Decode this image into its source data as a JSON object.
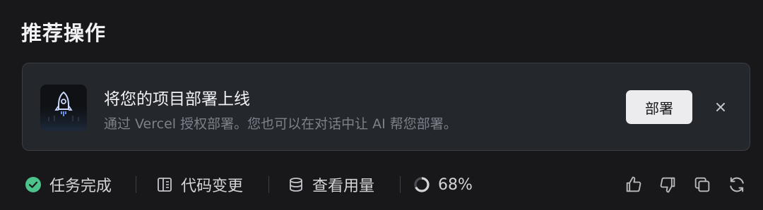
{
  "section": {
    "title": "推荐操作"
  },
  "deploy_card": {
    "icon": "rocket-icon",
    "title": "将您的项目部署上线",
    "description": "通过 Vercel 授权部署。您也可以在对话中让 AI 帮您部署。",
    "deploy_label": "部署",
    "close_icon": "close-icon"
  },
  "status_bar": {
    "task_done": {
      "icon": "check-circle-icon",
      "label": "任务完成",
      "color": "#4cc38a"
    },
    "code_changes": {
      "icon": "file-diff-icon",
      "label": "代码变更"
    },
    "usage": {
      "icon": "database-icon",
      "label": "查看用量"
    },
    "progress": {
      "icon": "progress-ring-icon",
      "label": "68%",
      "value": 68
    }
  },
  "actions": [
    {
      "name": "thumbs-up-icon"
    },
    {
      "name": "thumbs-down-icon"
    },
    {
      "name": "copy-icon"
    },
    {
      "name": "refresh-icon"
    }
  ],
  "colors": {
    "background": "#18181a",
    "card": "#24272c",
    "accent_green": "#4cc38a",
    "button": "#ececee"
  }
}
